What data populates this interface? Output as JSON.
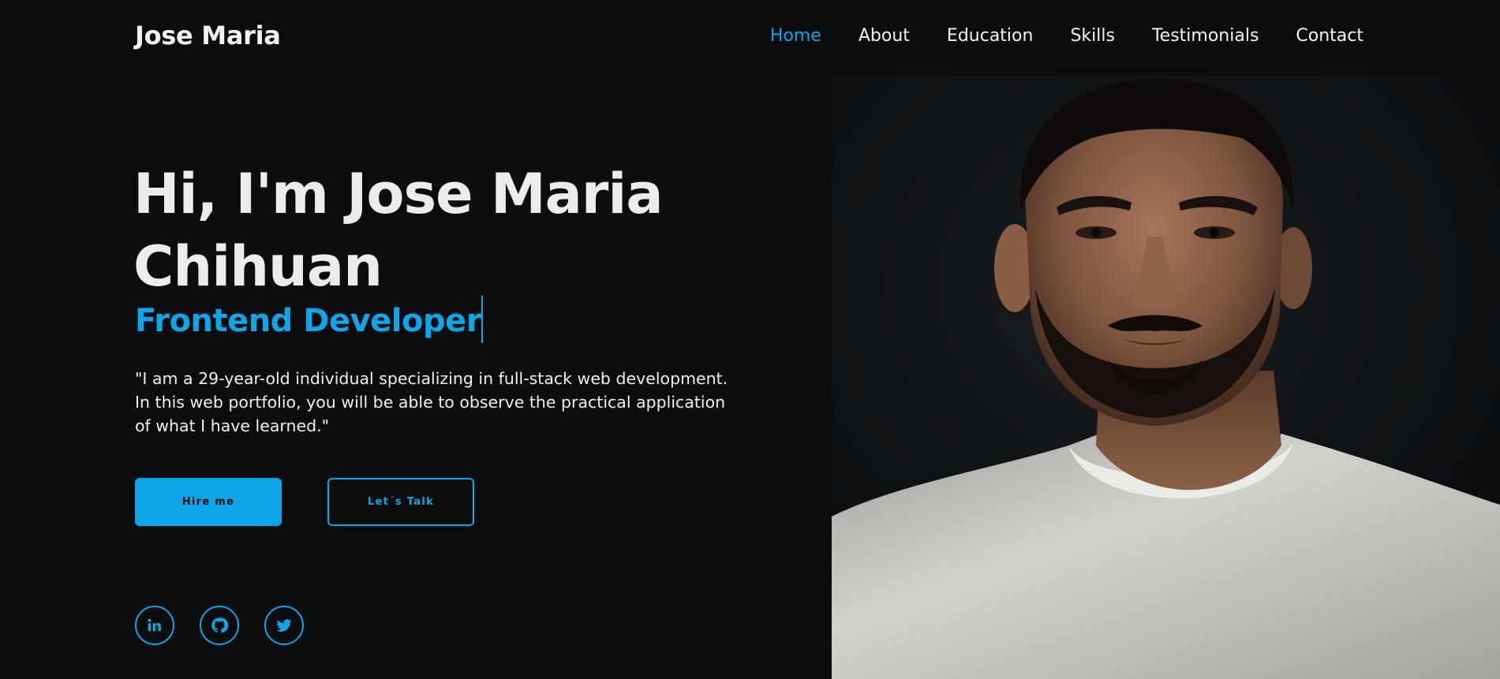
{
  "header": {
    "logo": "Jose Maria",
    "nav": [
      {
        "label": "Home",
        "active": true
      },
      {
        "label": "About",
        "active": false
      },
      {
        "label": "Education",
        "active": false
      },
      {
        "label": "Skills",
        "active": false
      },
      {
        "label": "Testimonials",
        "active": false
      },
      {
        "label": "Contact",
        "active": false
      }
    ]
  },
  "hero": {
    "title_line1": "Hi, I'm Jose Maria",
    "title_line2": "Chihuan",
    "role": "Frontend Developer",
    "description": "\"I am a 29-year-old individual specializing in full-stack web development. In this web portfolio, you will be able to observe the practical application of what I have learned.\"",
    "primary_button": "Hire me",
    "secondary_button": "Let´s Talk",
    "socials": [
      {
        "icon": "linkedin-icon",
        "label": "in"
      },
      {
        "icon": "github-icon"
      },
      {
        "icon": "twitter-icon"
      }
    ]
  },
  "colors": {
    "accent": "#0ea5e9",
    "background": "#0b0d0f",
    "text": "#f0f0f0"
  },
  "portrait": {
    "subject": "portrait-photo"
  }
}
